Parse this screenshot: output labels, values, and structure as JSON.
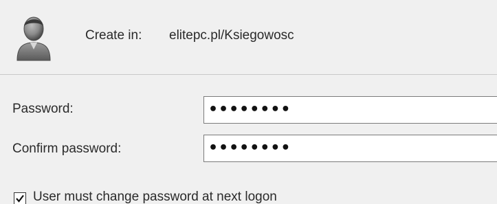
{
  "header": {
    "create_in_label": "Create in:",
    "create_in_value": "elitepc.pl/Ksiegowosc",
    "icon": "user-icon"
  },
  "form": {
    "password_label": "Password:",
    "password_value": "••••••••",
    "confirm_password_label": "Confirm password:",
    "confirm_password_value": "••••••••"
  },
  "options": {
    "must_change_password_label": "User must change password at next logon",
    "must_change_password_checked": true
  },
  "colors": {
    "background": "#f0f0f0",
    "input_background": "#ffffff",
    "divider": "#c8c8c8"
  }
}
